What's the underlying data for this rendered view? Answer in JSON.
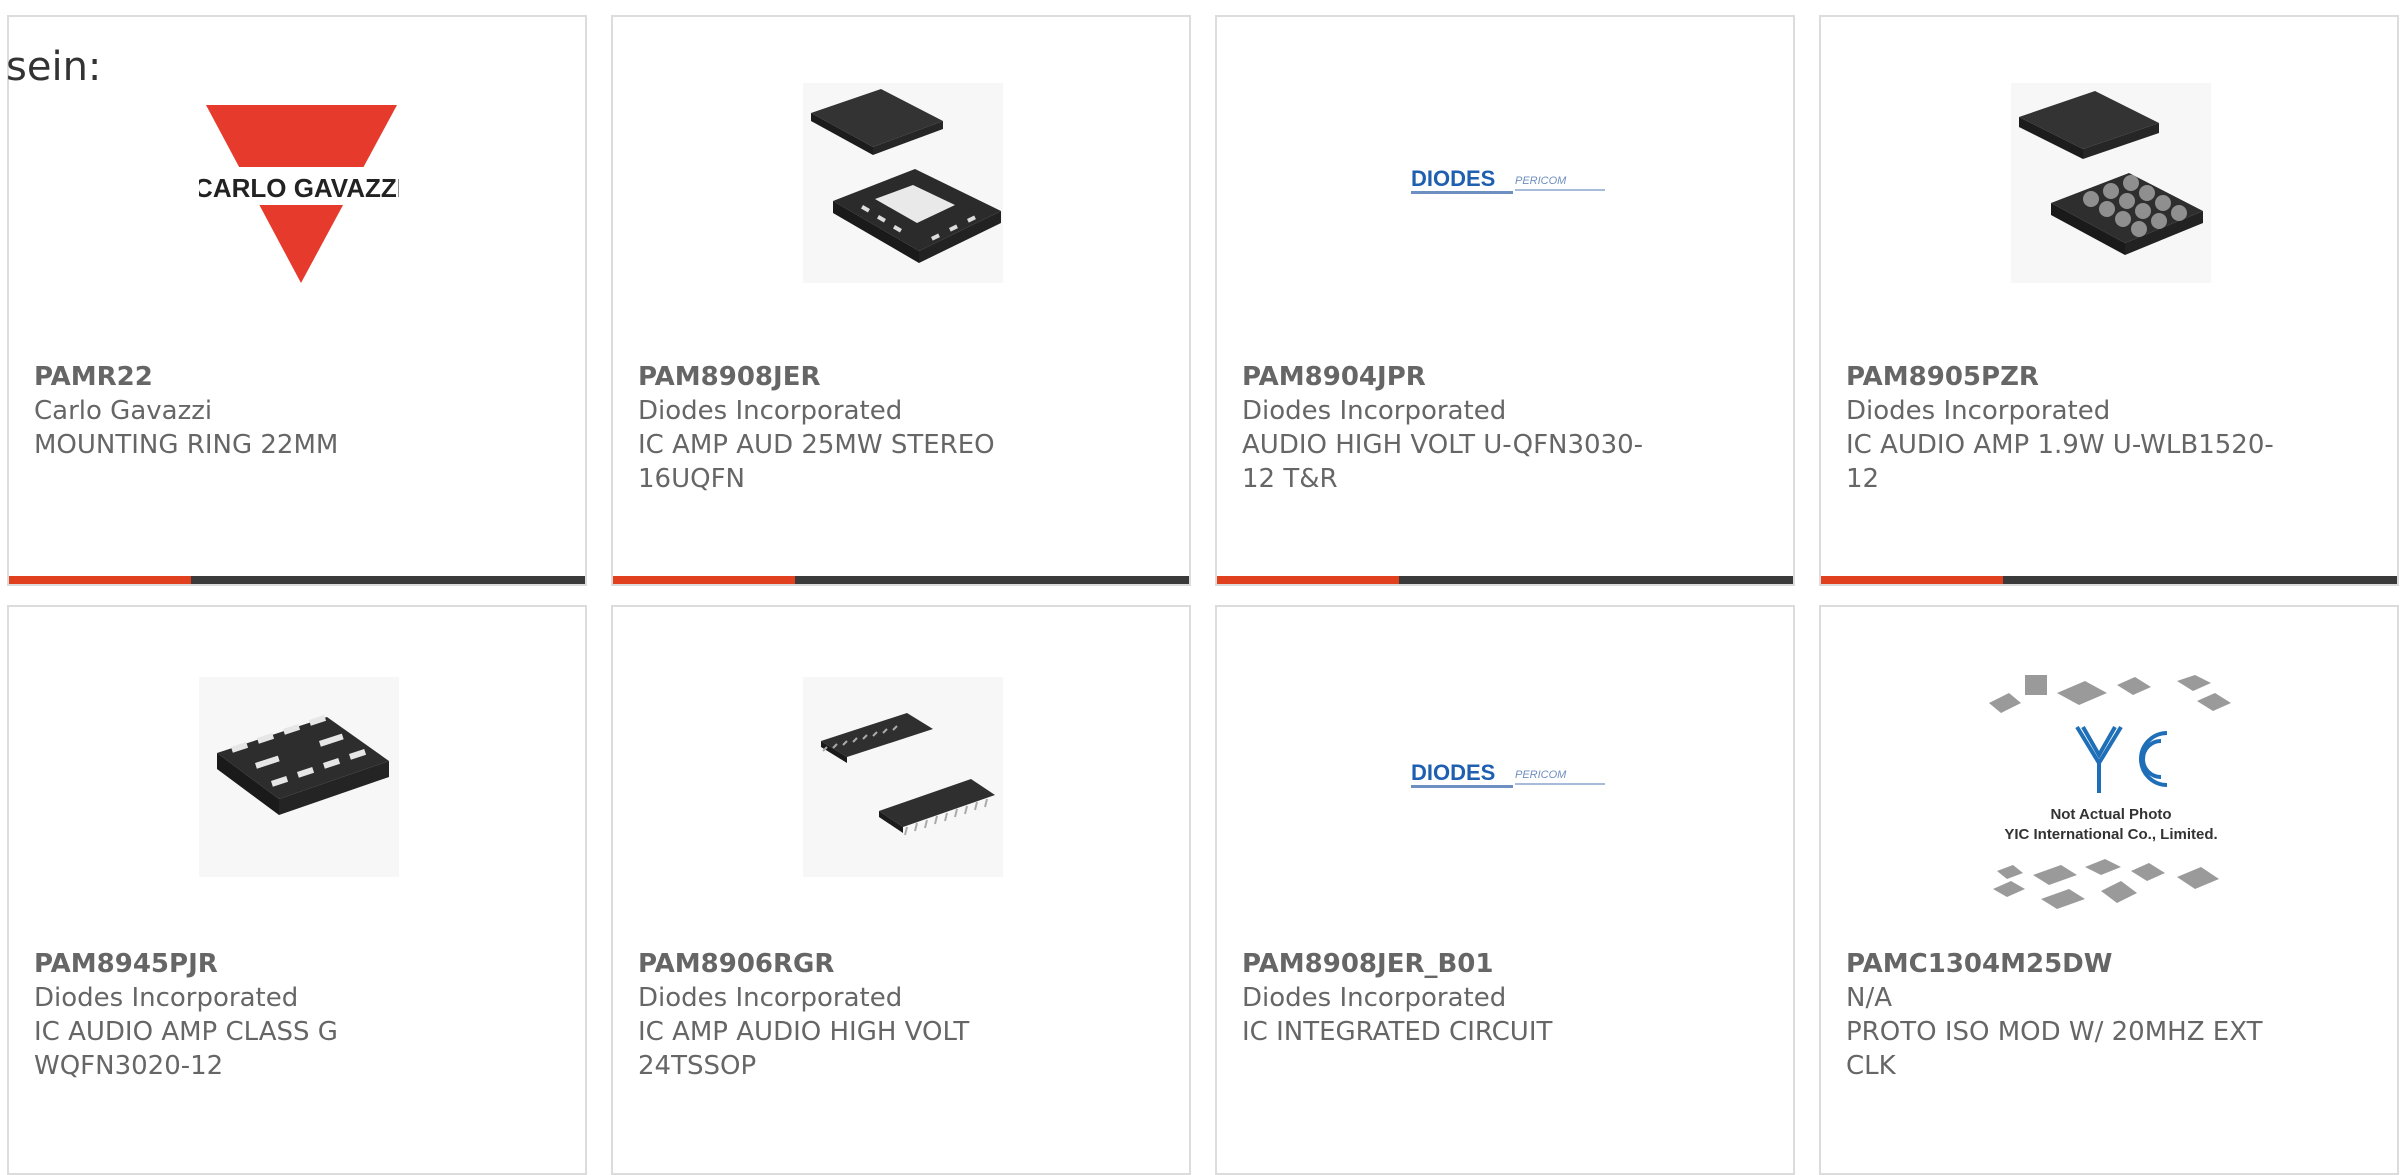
{
  "stray_text": "sein:",
  "colors": {
    "accent": "#e1401f",
    "bar": "#3a3a3a",
    "card_border": "#dcdcdc"
  },
  "products": [
    {
      "part": "PAMR22",
      "manufacturer": "Carlo Gavazzi",
      "desc1": "MOUNTING RING 22MM",
      "desc2": "",
      "image": "carlo-gavazzi-logo",
      "logo_text": "CARLO GAVAZZI"
    },
    {
      "part": "PAM8908JER",
      "manufacturer": "Diodes Incorporated",
      "desc1": "IC AMP AUD 25MW STEREO",
      "desc2": "16UQFN",
      "image": "qfn-chip"
    },
    {
      "part": "PAM8904JPR",
      "manufacturer": "Diodes Incorporated",
      "desc1": "AUDIO HIGH VOLT U-QFN3030-",
      "desc2": "12 T&R",
      "image": "diodes-pericom-logo",
      "logo_text": "DIODES",
      "logo_text2": "PERICOM"
    },
    {
      "part": "PAM8905PZR",
      "manufacturer": "Diodes Incorporated",
      "desc1": "IC AUDIO AMP 1.9W U-WLB1520-",
      "desc2": "12",
      "image": "wlb-chip"
    },
    {
      "part": "PAM8945PJR",
      "manufacturer": "Diodes Incorporated",
      "desc1": "IC AUDIO AMP CLASS G",
      "desc2": "WQFN3020-12",
      "image": "wqfn-chip"
    },
    {
      "part": "PAM8906RGR",
      "manufacturer": "Diodes Incorporated",
      "desc1": "IC AMP AUDIO HIGH VOLT",
      "desc2": "24TSSOP",
      "image": "tssop-chips"
    },
    {
      "part": "PAM8908JER_B01",
      "manufacturer": "Diodes Incorporated",
      "desc1": "IC INTEGRATED CIRCUIT",
      "desc2": "",
      "image": "diodes-pericom-logo",
      "logo_text": "DIODES",
      "logo_text2": "PERICOM"
    },
    {
      "part": "PAMC1304M25DW",
      "manufacturer": "N/A",
      "desc1": "PROTO ISO MOD W/ 20MHZ EXT",
      "desc2": "CLK",
      "image": "yic-placeholder",
      "logo_text": "YIC",
      "note1": "Not Actual Photo",
      "note2": "YIC International Co., Limited."
    }
  ]
}
